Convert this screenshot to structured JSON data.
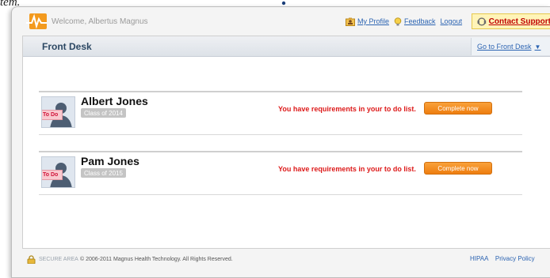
{
  "caption": {
    "text": "tem."
  },
  "header": {
    "welcome": "Welcome, Albertus Magnus",
    "my_profile": "My Profile",
    "feedback": "Feedback",
    "logout": "Logout",
    "contact_support": "Contact Support"
  },
  "panel": {
    "title": "Front Desk",
    "goto_label": "Go to Front Desk"
  },
  "students": [
    {
      "name": "Albert Jones",
      "class_label": "Class of 2014",
      "badge": "To Do",
      "message": "You have requirements in your to do list.",
      "button": "Complete now"
    },
    {
      "name": "Pam Jones",
      "class_label": "Class of 2015",
      "badge": "To Do",
      "message": "You have requirements in your to do list.",
      "button": "Complete now"
    }
  ],
  "footer": {
    "secure": "SECURE AREA",
    "copyright": "© 2006-2011 Magnus Health Technology. All Rights Reserved.",
    "hipaa": "HIPAA",
    "privacy": "Privacy Policy"
  },
  "colors": {
    "accent_orange": "#ee7d0f",
    "link_blue": "#2c64b2",
    "alert_red": "#dd1a1a",
    "support_bg": "#fff4b8"
  },
  "icons": [
    "magnus-logo",
    "profile-icon",
    "feedback-icon",
    "contact-support-icon",
    "dropdown-caret-icon",
    "lock-icon",
    "avatar-icon"
  ]
}
